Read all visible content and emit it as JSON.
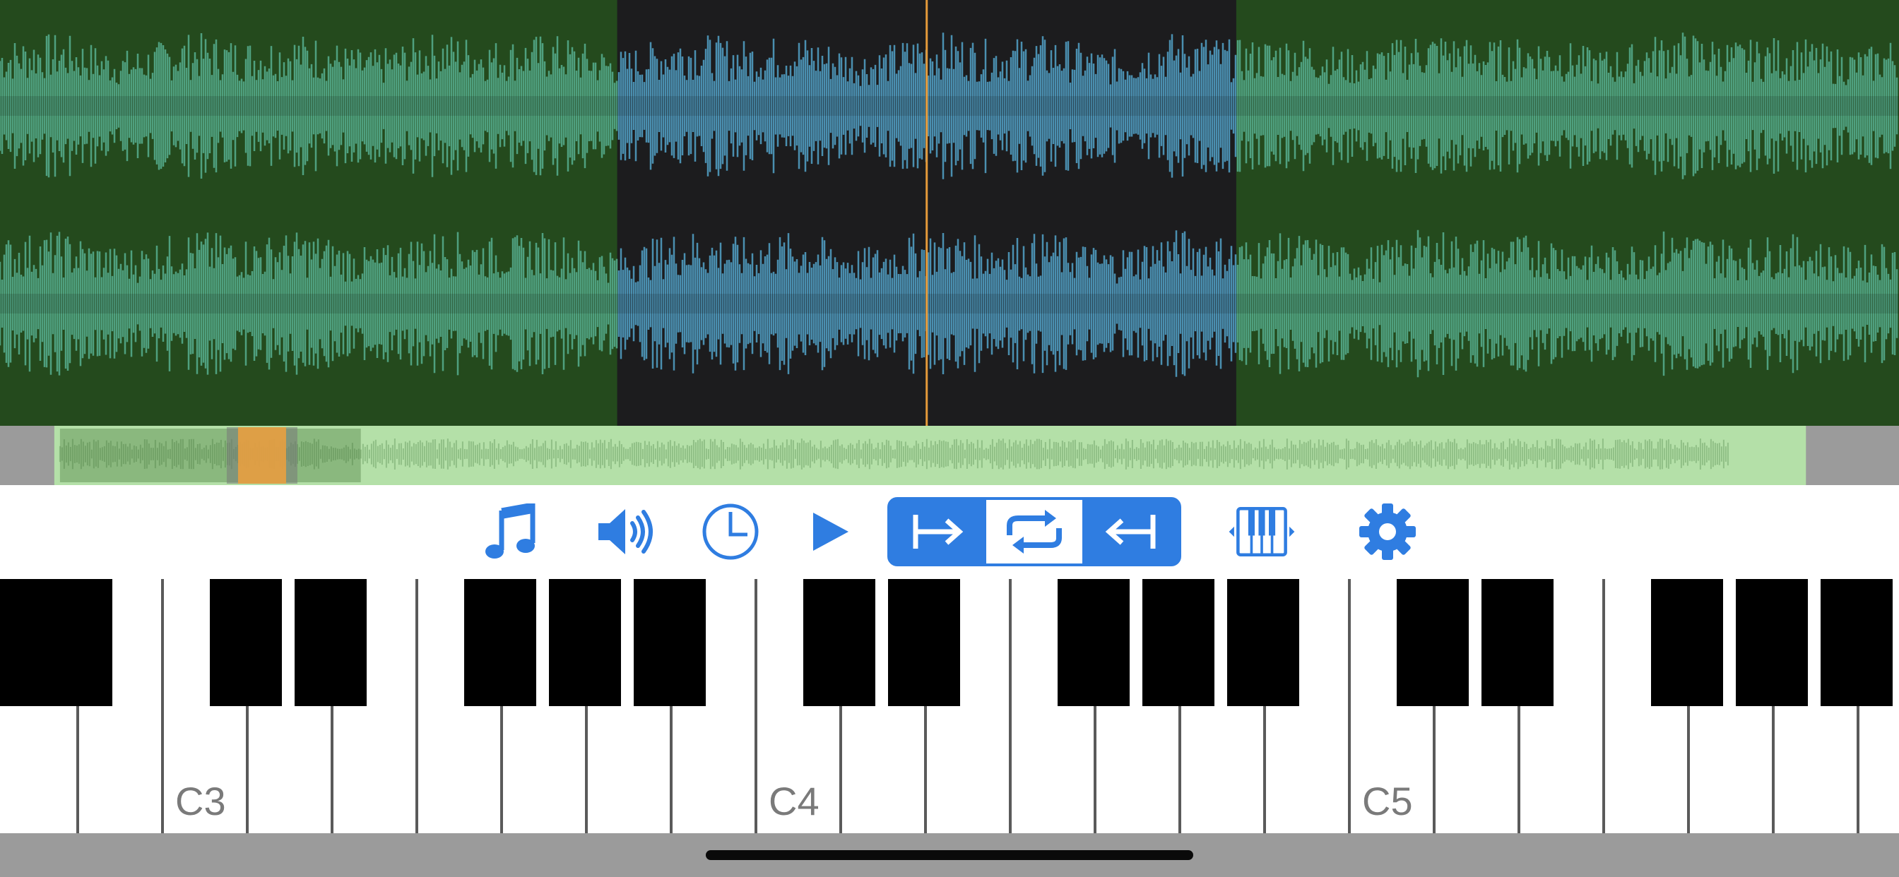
{
  "colors": {
    "wave_bg": "#244a1d",
    "wave_selected_bg": "#1c1c1e",
    "wave_green": "#4fa07f",
    "wave_blue": "#4a8fb0",
    "playhead": "#e59a3a",
    "overview_bg": "#9b9b9b",
    "overview_track": "#b4e0a8",
    "overview_wave": "#8fbf85",
    "overview_handle": "#e8a040",
    "accent": "#2f7de1",
    "toolbar_bg": "#ffffff",
    "key_label": "#7a7a7a"
  },
  "waveform": {
    "selection_start_fraction": 0.325,
    "selection_end_fraction": 0.651,
    "playhead_fraction": 0.5
  },
  "overview": {
    "track_start_fraction": 0.0286,
    "track_end_fraction": 0.951,
    "loaded_end_fraction": 0.19,
    "handle_fraction": 0.138
  },
  "toolbar": {
    "buttons": [
      {
        "name": "music-note-icon"
      },
      {
        "name": "speaker-icon"
      },
      {
        "name": "clock-icon"
      },
      {
        "name": "play-icon"
      },
      {
        "name": "loop-start-icon"
      },
      {
        "name": "loop-icon"
      },
      {
        "name": "loop-end-icon"
      },
      {
        "name": "keyboard-width-icon"
      },
      {
        "name": "gear-icon"
      }
    ]
  },
  "keyboard": {
    "labels": [
      {
        "text": "C3"
      },
      {
        "text": "C4"
      },
      {
        "text": "C5"
      }
    ]
  }
}
